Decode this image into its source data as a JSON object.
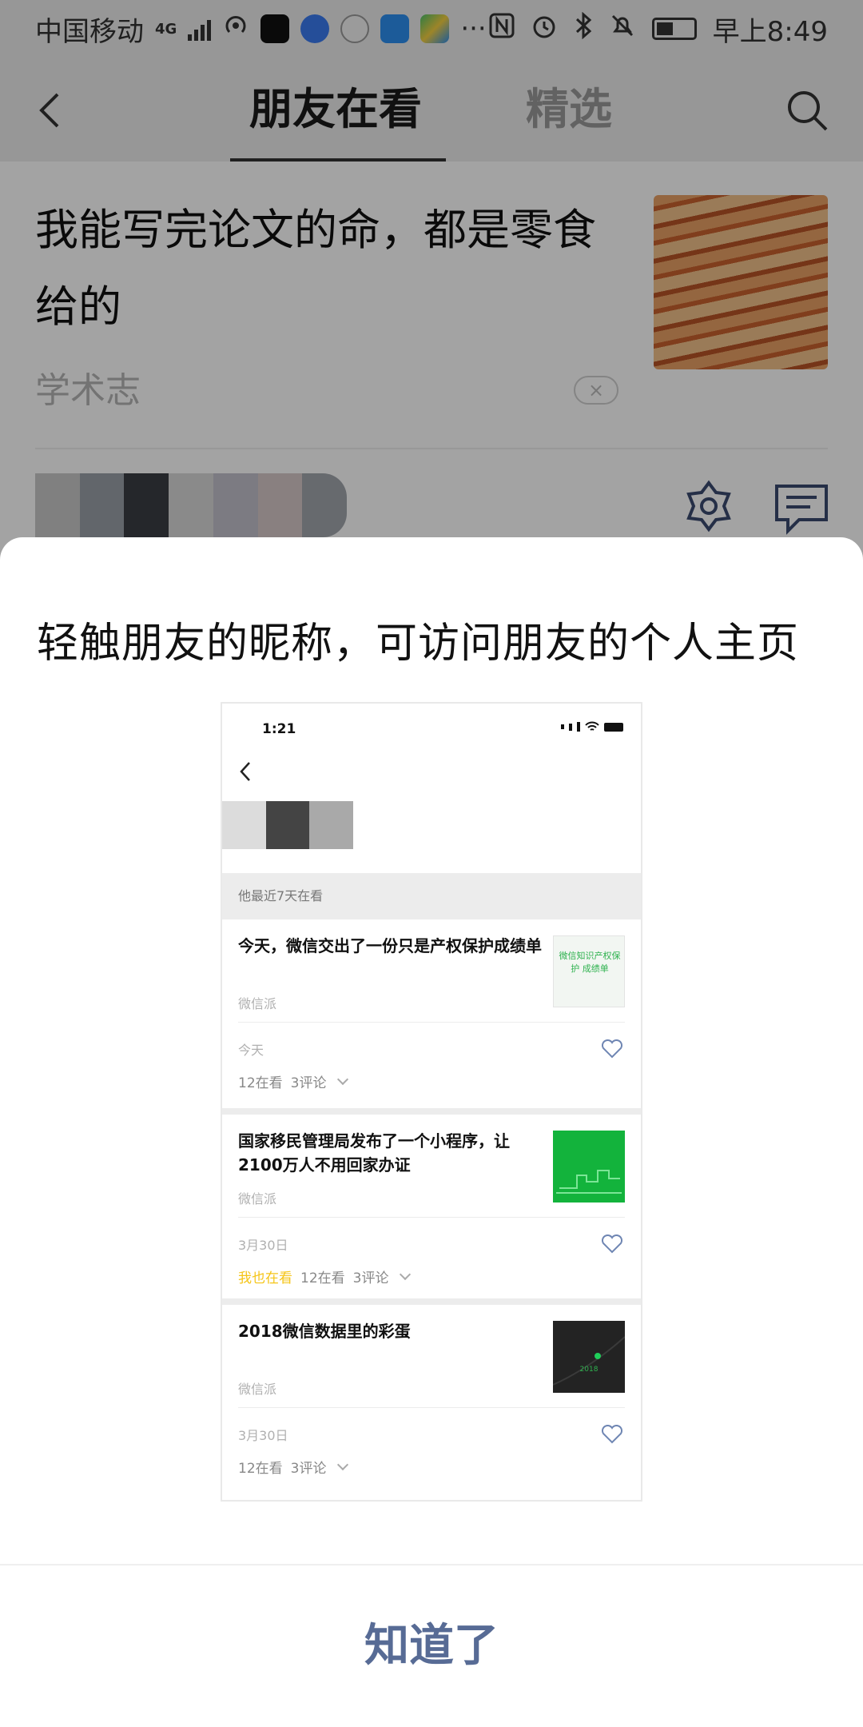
{
  "status_bar": {
    "carrier": "中国移动",
    "network_type": "4G",
    "time": "早上8:49",
    "more": "···"
  },
  "nav": {
    "tabs": [
      {
        "label": "朋友在看",
        "active": true
      },
      {
        "label": "精选",
        "active": false
      }
    ],
    "icons": [
      "back-arrow-icon",
      "search-icon"
    ]
  },
  "article": {
    "title": "我能写完论文的命，都是零食给的",
    "source": "学术志",
    "dismiss": "×",
    "icons": [
      "like-icon",
      "comment-icon"
    ]
  },
  "sheet": {
    "title": "轻触朋友的昵称，可访问朋友的个人主页",
    "confirm_label": "知道了",
    "accent_color": "#576b95"
  },
  "preview": {
    "time": "1:21",
    "section_label": "他最近7天在看",
    "cards": [
      {
        "title": "今天，微信交出了一份只是产权保护成绩单",
        "source": "微信派",
        "thumb_text": "微信知识产权保护 成绩单",
        "date": "今天",
        "also_viewing": "",
        "views": "12在看",
        "comments": "3评论"
      },
      {
        "title": "国家移民管理局发布了一个小程序，让2100万人不用回家办证",
        "source": "微信派",
        "thumb_text": "",
        "date": "3月30日",
        "also_viewing": "我也在看",
        "views": "12在看",
        "comments": "3评论"
      },
      {
        "title": "2018微信数据里的彩蛋",
        "source": "微信派",
        "thumb_text": "2018",
        "date": "3月30日",
        "also_viewing": "",
        "views": "12在看",
        "comments": "3评论"
      }
    ]
  }
}
